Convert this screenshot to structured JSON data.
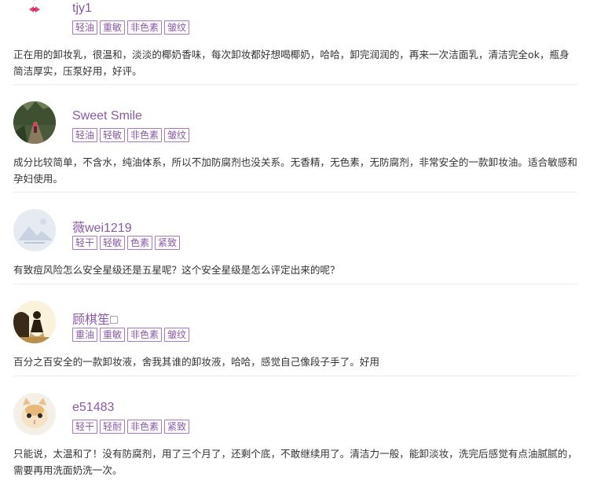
{
  "reviews": [
    {
      "username": "tjy1",
      "avatar_icon": "bow-icon",
      "tags": [
        "轻油",
        "重敏",
        "非色素",
        "皱纹"
      ],
      "content": "正在用的卸妆乳，很温和，淡淡的椰奶香味，每次卸妆都好想喝椰奶，哈哈，卸完润润的，再来一次洁面乳，清洁完全ok，瓶身简洁厚实，压泵好用，好评。"
    },
    {
      "username": "Sweet Smile",
      "avatar_icon": "forest-path-photo",
      "tags": [
        "轻油",
        "轻敏",
        "非色素",
        "皱纹"
      ],
      "content": "成分比较简单，不含水，纯油体系，所以不加防腐剂也没关系。无香精，无色素，无防腐剂，非常安全的一款卸妆油。适合敏感和孕妇使用。"
    },
    {
      "username": "薇wei1219",
      "avatar_icon": "default-mountain-avatar",
      "tags": [
        "轻干",
        "轻敏",
        "色素",
        "紧致"
      ],
      "content": "有致痘风险怎么安全星级还是五星呢？这个安全星级是怎么评定出来的呢？"
    },
    {
      "username": "顾棋笙□",
      "avatar_icon": "dancer-silhouette-photo",
      "tags": [
        "重油",
        "重敏",
        "非色素",
        "皱纹"
      ],
      "content": "百分之百安全的一款卸妆液，舍我其谁的卸妆液，哈哈，感觉自己像段子手了。好用"
    },
    {
      "username": "e51483",
      "avatar_icon": "cat-face-avatar",
      "tags": [
        "轻干",
        "轻耐",
        "非色素",
        "紧致"
      ],
      "content": "只能说，太温和了！没有防腐剂，用了三个月了，还剩个底，不敢继续用了。清洁力一般，能卸淡妆，洗完后感觉有点油腻腻的，需要再用洗面奶洗一次。"
    }
  ]
}
